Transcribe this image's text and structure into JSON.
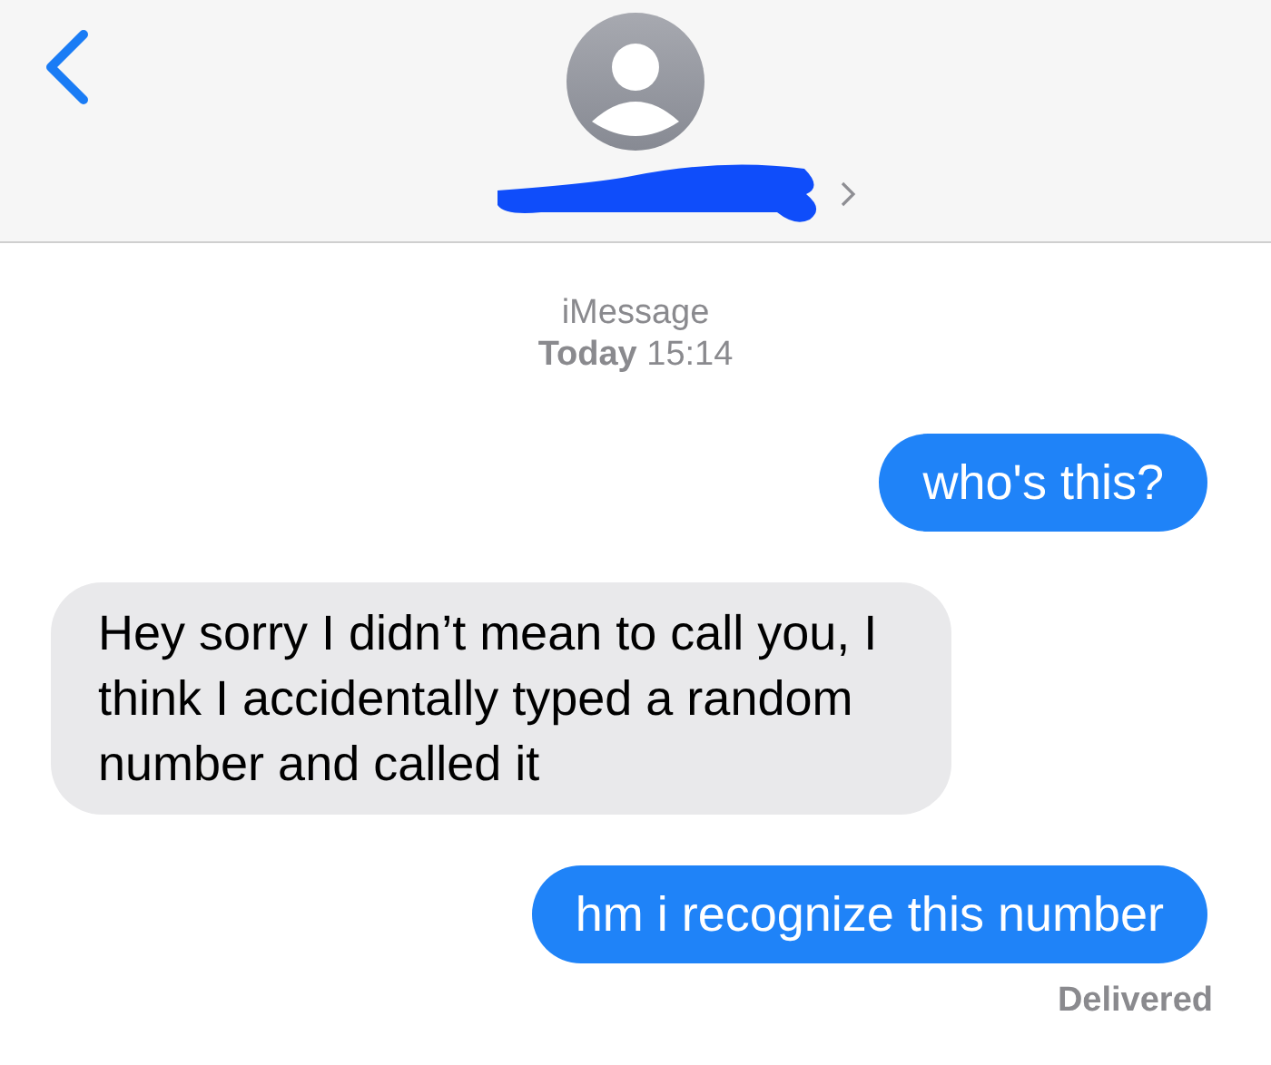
{
  "header": {
    "name_redacted": true
  },
  "thread_info": {
    "service": "iMessage",
    "timestamp": "**Today** 15:14"
  },
  "messages": [
    {
      "kind": "outgoing",
      "text": "who's this?"
    },
    {
      "kind": "incoming",
      "text": "Hey sorry I didn’t mean to call you, I think I accidentally typed a random number and called it"
    },
    {
      "kind": "outgoing",
      "text": "hm i recognize this number"
    }
  ],
  "status": "Delivered"
}
